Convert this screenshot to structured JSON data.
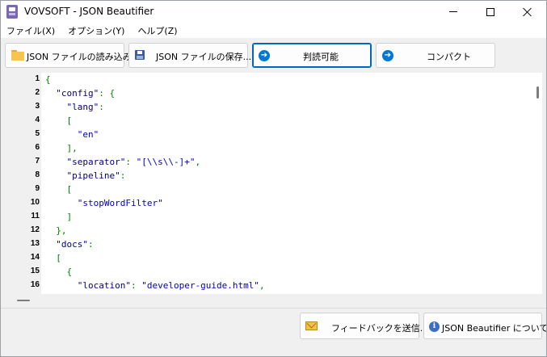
{
  "window": {
    "title": "VOVSOFT - JSON Beautifier"
  },
  "menu": {
    "items": [
      "ファイル(X)",
      "オプション(Y)",
      "ヘルプ(Z)"
    ]
  },
  "toolbar": {
    "open_label": "JSON ファイルの読み込み...",
    "save_label": "JSON ファイルの保存...",
    "beautify_label": "判読可能",
    "compact_label": "コンパクト"
  },
  "editor": {
    "lines": [
      {
        "n": "1",
        "indent": "",
        "parts": [
          [
            "punct",
            "{"
          ]
        ]
      },
      {
        "n": "2",
        "indent": "  ",
        "parts": [
          [
            "key",
            "\"config\""
          ],
          [
            "punct",
            ": {"
          ]
        ]
      },
      {
        "n": "3",
        "indent": "    ",
        "parts": [
          [
            "key",
            "\"lang\""
          ],
          [
            "punct",
            ":"
          ]
        ]
      },
      {
        "n": "4",
        "indent": "    ",
        "parts": [
          [
            "punct",
            "["
          ]
        ]
      },
      {
        "n": "5",
        "indent": "      ",
        "parts": [
          [
            "str",
            "\"en\""
          ]
        ]
      },
      {
        "n": "6",
        "indent": "    ",
        "parts": [
          [
            "punct",
            "],"
          ]
        ]
      },
      {
        "n": "7",
        "indent": "    ",
        "parts": [
          [
            "key",
            "\"separator\""
          ],
          [
            "punct",
            ": "
          ],
          [
            "str",
            "\"[\\\\s\\\\-]+\""
          ],
          [
            "punct",
            ","
          ]
        ]
      },
      {
        "n": "8",
        "indent": "    ",
        "parts": [
          [
            "key",
            "\"pipeline\""
          ],
          [
            "punct",
            ":"
          ]
        ]
      },
      {
        "n": "9",
        "indent": "    ",
        "parts": [
          [
            "punct",
            "["
          ]
        ]
      },
      {
        "n": "10",
        "indent": "      ",
        "parts": [
          [
            "str",
            "\"stopWordFilter\""
          ]
        ]
      },
      {
        "n": "11",
        "indent": "    ",
        "parts": [
          [
            "punct",
            "]"
          ]
        ]
      },
      {
        "n": "12",
        "indent": "  ",
        "parts": [
          [
            "punct",
            "},"
          ]
        ]
      },
      {
        "n": "13",
        "indent": "  ",
        "parts": [
          [
            "key",
            "\"docs\""
          ],
          [
            "punct",
            ":"
          ]
        ]
      },
      {
        "n": "14",
        "indent": "  ",
        "parts": [
          [
            "punct",
            "["
          ]
        ]
      },
      {
        "n": "15",
        "indent": "    ",
        "parts": [
          [
            "punct",
            "{"
          ]
        ]
      },
      {
        "n": "16",
        "indent": "      ",
        "parts": [
          [
            "key",
            "\"location\""
          ],
          [
            "punct",
            ": "
          ],
          [
            "str",
            "\"developer-guide.html\""
          ],
          [
            "punct",
            ","
          ]
        ]
      }
    ]
  },
  "footer": {
    "feedback_label": "フィードバックを送信...",
    "about_label": "JSON Beautifier について..."
  },
  "icons": {
    "app": "app-icon",
    "open": "folder-icon",
    "save": "disk-icon",
    "beautify": "arrow-right-icon",
    "compact": "arrow-right-icon",
    "feedback": "envelope-icon",
    "about": "info-icon"
  },
  "colors": {
    "punct": "#008000",
    "key": "#000080",
    "string": "#0000c0",
    "active_border": "#0067c0",
    "accent": "#0078d4"
  }
}
